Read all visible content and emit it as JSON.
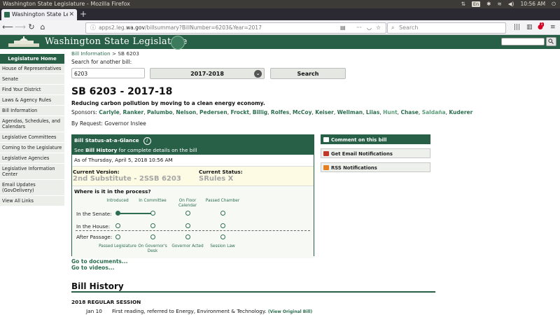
{
  "os": {
    "window_title": "Washington State Legislature - Mozilla Firefox",
    "kbd": "En",
    "time": "10:56 AM"
  },
  "browser": {
    "tab_title": "Washington State Legislature",
    "url_domain": "wa.gov",
    "url_prefix": "apps2.leg.",
    "url_suffix": "/billsummary?BillNumber=6203&Year=2017",
    "search_placeholder": "Search",
    "badge": "1"
  },
  "banner": {
    "logo_text": "Washington State Legislature"
  },
  "sidebar": {
    "home": "Legislature Home",
    "items": [
      "House of Representatives",
      "Senate",
      "Find Your District",
      "Laws & Agency Rules",
      "Bill Information",
      "Agendas, Schedules, and Calendars",
      "Legislative Committees",
      "Coming to the Legislature",
      "Legislative Agencies",
      "Legislative Information Center",
      "Email Updates (GovDelivery)",
      "View All Links"
    ]
  },
  "breadcrumb": {
    "link": "Bill Information",
    "sep": " > ",
    "current": "SB 6203"
  },
  "search": {
    "label": "Search for another bill:",
    "value": "6203",
    "year": "2017-2018",
    "button": "Search"
  },
  "bill": {
    "title": "SB 6203 - 2017-18",
    "description": "Reducing carbon pollution by moving to a clean energy economy.",
    "sponsors_label": "Sponsors:",
    "sponsors": [
      "Carlyle",
      "Ranker",
      "Palumbo",
      "Nelson",
      "Pedersen",
      "Frockt",
      "Billig",
      "Rolfes",
      "McCoy",
      "Keiser",
      "Wellman",
      "Liias",
      "Hunt",
      "Chase",
      "Saldaña",
      "Kuderer"
    ],
    "by_request": "By Request: Governor Inslee"
  },
  "status": {
    "header": "Bill Status-at-a-Glance",
    "info_icon": "i",
    "see_prefix": "See ",
    "see_link": "Bill History",
    "see_suffix": " for complete details on the bill",
    "as_of": "As of Thursday, April 5, 2018 10:56 AM",
    "current_version_label": "Current Version:",
    "current_version": "2nd Substitute - 2SSB 6203",
    "current_status_label": "Current Status:",
    "current_status": "SRules X",
    "where_label": "Where is it in the process?",
    "top_steps": [
      "Introduced",
      "In Committee",
      "On Floor Calendar",
      "Passed Chamber"
    ],
    "rows": [
      "In the Senate:",
      "In the House:",
      "After Passage:"
    ],
    "bottom_steps": [
      "Passed Legislature",
      "On Governor's Desk",
      "Governor Acted",
      "Session Law"
    ],
    "senate_progress": 2
  },
  "links": {
    "documents": "Go to documents...",
    "videos": "Go to videos..."
  },
  "right_buttons": [
    "Comment on this bill",
    "Get Email Notifications",
    "RSS Notifications"
  ],
  "history": {
    "heading": "Bill History",
    "session": "2018 REGULAR SESSION",
    "entries": [
      {
        "date": "Jan 10",
        "text": "First reading, referred to Energy, Environment & Technology.",
        "link": "(View Original Bill)"
      }
    ]
  },
  "colors": {
    "brand": "#285f47",
    "link": "#2c6e4f",
    "highlight": "#fdfbe4"
  }
}
